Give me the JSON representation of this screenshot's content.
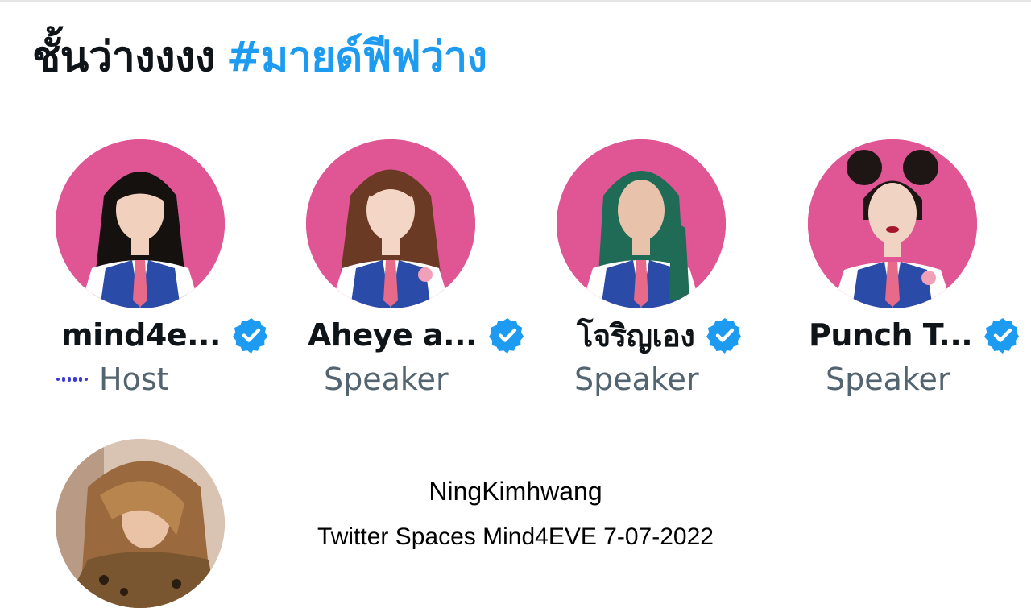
{
  "space": {
    "title": "ชั้นว่างงงง",
    "hashtag": "#มายด์ฟีฟว่าง"
  },
  "participants": [
    {
      "name": "mind4e...",
      "role": "Host",
      "verified": true,
      "speaking_indicator": true
    },
    {
      "name": "Aheye a...",
      "role": "Speaker",
      "verified": true
    },
    {
      "name": "โจริญเอง",
      "role": "Speaker",
      "verified": true
    },
    {
      "name": "Punch T...",
      "role": "Speaker",
      "verified": true
    }
  ],
  "overlay": {
    "line1": "NingKimhwang",
    "line2": "Twitter Spaces Mind4EVE  7-07-2022"
  },
  "colors": {
    "accent": "#1d9bf0",
    "avatar_background": "#e05593",
    "uniform_vest": "#2b4ba8",
    "role_text": "#536471",
    "speaking_indicator": "#3b3bd9"
  },
  "icons": [
    "verified-badge-icon",
    "speaking-indicator-icon"
  ]
}
